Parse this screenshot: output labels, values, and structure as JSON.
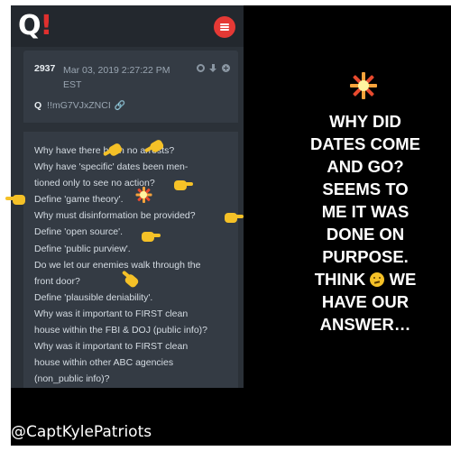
{
  "app": {
    "logo": "Q",
    "logo_accent": "!"
  },
  "post": {
    "number": "2937",
    "date_line1": "Mar 03, 2019 2:27:22 PM",
    "date_line2": "EST",
    "author": "Q",
    "tripcode": "!!mG7VJxZNCI",
    "lines": [
      "Why have there been no arrests?",
      "Why have 'specific' dates been men-",
      "tioned only to see no action?",
      "Define 'game theory'.",
      "Why must disinformation be provided?",
      "Define 'open source'.",
      "Define 'public purview'.",
      "Do we let our enemies walk through the",
      "front door?",
      "Define 'plausible deniability'.",
      "Why was it important to FIRST clean",
      "house within the FBI & DOJ (public info)?",
      "Why was it important to FIRST clean",
      "house within other ABC agencies",
      "(non_public info)?"
    ]
  },
  "caption": {
    "lines": [
      "WHY DID",
      "DATES COME",
      "AND GO?",
      "SEEMS TO",
      "ME IT WAS",
      "DONE ON",
      "PURPOSE.",
      "THINK",
      "WE",
      "HAVE OUR",
      "ANSWER…"
    ]
  },
  "watermark": "@CaptKylePatriots",
  "colors": {
    "accent_red": "#e53935",
    "panel": "#343b44",
    "background": "#000000"
  },
  "icons": [
    "menu-icon",
    "share-icon",
    "download-icon",
    "add-icon",
    "link-icon",
    "pointing-hand-icon",
    "collision-icon",
    "thinking-face-icon"
  ]
}
